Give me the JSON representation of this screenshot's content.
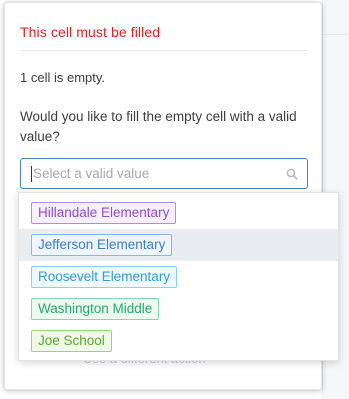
{
  "panel": {
    "error_title": "This cell must be filled",
    "empty_note": "1 cell is empty.",
    "question": "Would you like to fill the empty cell with a valid value?",
    "select": {
      "placeholder": "Select a valid value",
      "icon": "search-icon"
    },
    "secondary_action": "Use a different action"
  },
  "options": [
    {
      "label": "Hillandale Elementary",
      "text_color": "#8a4fd4",
      "bg_color": "#f6efff",
      "border_color": "#b68be8",
      "highlighted": false
    },
    {
      "label": "Jefferson Elementary",
      "text_color": "#3f7dc4",
      "bg_color": "#eef5fd",
      "border_color": "#8ab6e6",
      "highlighted": true
    },
    {
      "label": "Roosevelt Elementary",
      "text_color": "#2f9fd6",
      "bg_color": "#eef9fe",
      "border_color": "#8fd0ef",
      "highlighted": false
    },
    {
      "label": "Washington Middle",
      "text_color": "#27a86a",
      "bg_color": "#ecfaf2",
      "border_color": "#86d6ad",
      "highlighted": false
    },
    {
      "label": "Joe School",
      "text_color": "#5da62b",
      "bg_color": "#f0fae8",
      "border_color": "#9bd76c",
      "highlighted": false
    }
  ],
  "colors": {
    "error": "#e02424",
    "focus_border": "#4b82b9",
    "highlight_row": "#e9edf2"
  }
}
